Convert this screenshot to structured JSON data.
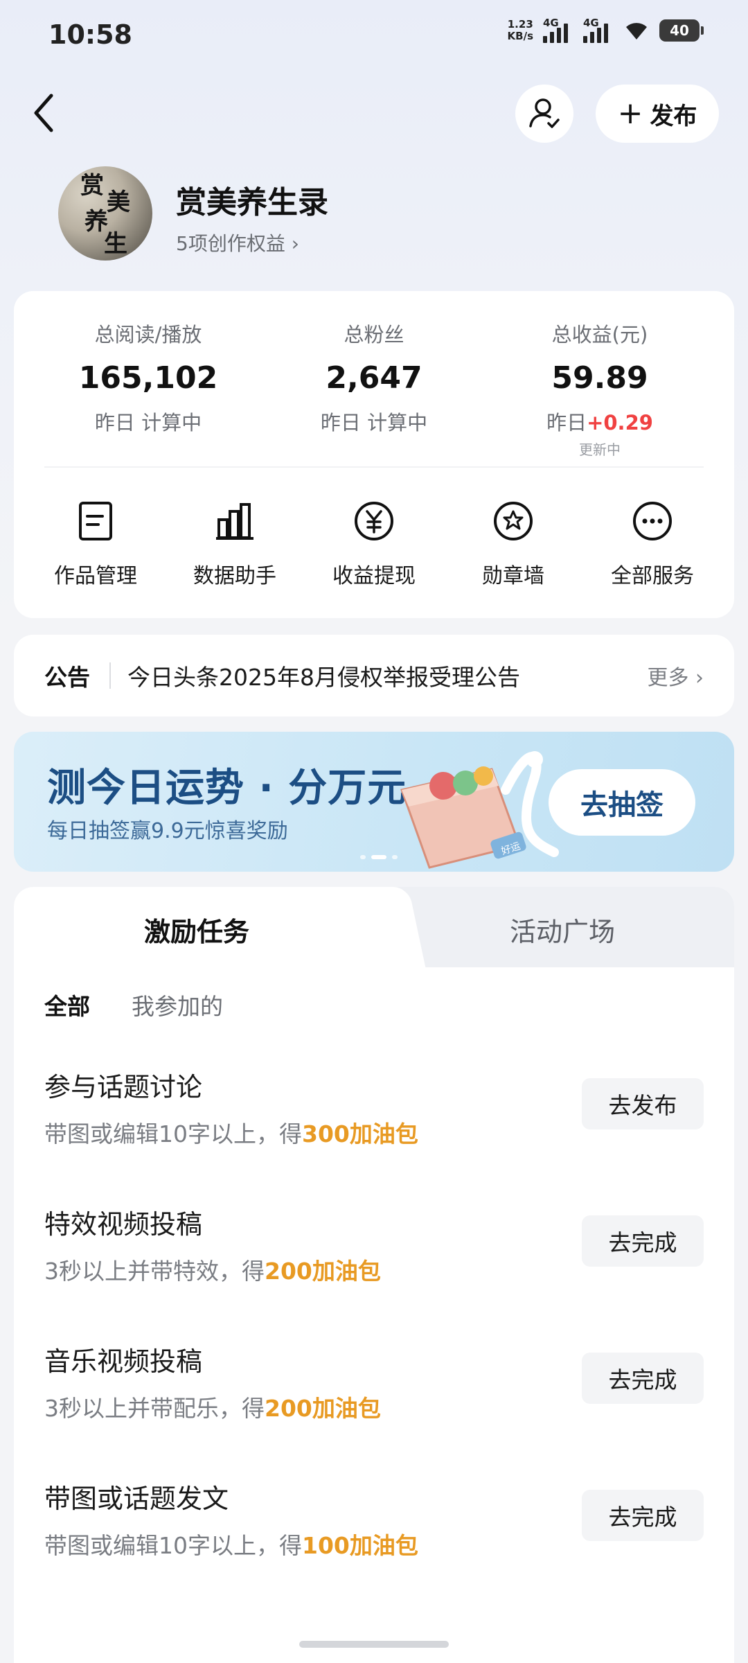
{
  "status_bar": {
    "time": "10:58",
    "net_speed_value": "1.23",
    "net_speed_unit": "KB/s",
    "sim1": "4G",
    "sim2": "4G",
    "battery": "40"
  },
  "header": {
    "publish_label": "发布",
    "publish_plus": "+"
  },
  "profile": {
    "name": "赏美养生录",
    "avatar_calligraphy": [
      "赏",
      "美",
      "养",
      "生"
    ],
    "rights_text": "5项创作权益",
    "rights_chevron": "›"
  },
  "stats": [
    {
      "label": "总阅读/播放",
      "value": "165,102",
      "sub": "昨日 计算中"
    },
    {
      "label": "总粉丝",
      "value": "2,647",
      "sub": "昨日 计算中"
    },
    {
      "label": "总收益(元)",
      "value": "59.89",
      "sub_prefix": "昨日",
      "sub_delta": "+0.29",
      "note": "更新中"
    }
  ],
  "services": [
    {
      "label": "作品管理",
      "icon": "document-icon"
    },
    {
      "label": "数据助手",
      "icon": "bar-chart-icon"
    },
    {
      "label": "收益提现",
      "icon": "yuan-icon"
    },
    {
      "label": "勋章墙",
      "icon": "badge-icon"
    },
    {
      "label": "全部服务",
      "icon": "more-icon"
    }
  ],
  "notice": {
    "tag": "公告",
    "text": "今日头条2025年8月侵权举报受理公告",
    "more": "更多",
    "more_chevron": "›"
  },
  "banner": {
    "title": "测今日运势 · 分万元",
    "subtitle": "每日抽签赢9.9元惊喜奖励",
    "button": "去抽签",
    "art_tag": "好运",
    "slide_count": 3,
    "active_slide": 2
  },
  "tasks": {
    "tabs": [
      "激励任务",
      "活动广场"
    ],
    "active_tab": 0,
    "filters": [
      "全部",
      "我参加的"
    ],
    "active_filter": 0,
    "items": [
      {
        "title": "参与话题讨论",
        "desc_prefix": "带图或编辑10字以上，得",
        "reward": "300加油包",
        "button": "去发布"
      },
      {
        "title": "特效视频投稿",
        "desc_prefix": "3秒以上并带特效，得",
        "reward": "200加油包",
        "button": "去完成"
      },
      {
        "title": "音乐视频投稿",
        "desc_prefix": "3秒以上并带配乐，得",
        "reward": "200加油包",
        "button": "去完成"
      },
      {
        "title": "带图或话题发文",
        "desc_prefix": "带图或编辑10字以上，得",
        "reward": "100加油包",
        "button": "去完成"
      }
    ]
  },
  "colors": {
    "accent_orange": "#e89a23",
    "positive_red": "#f04141",
    "banner_blue": "#1c4e84"
  }
}
